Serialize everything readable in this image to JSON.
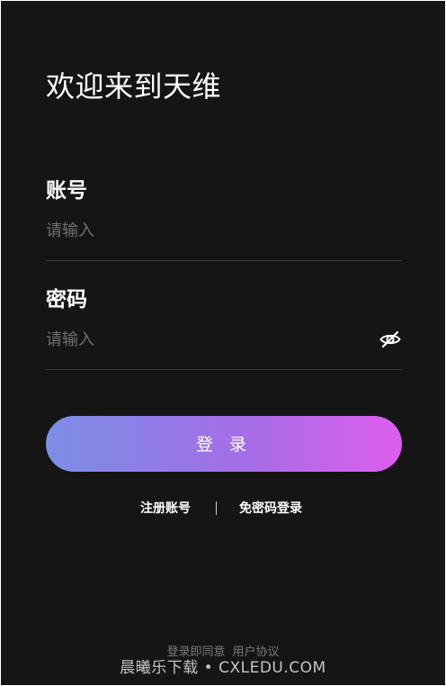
{
  "page": {
    "title": "欢迎来到天维"
  },
  "account": {
    "label": "账号",
    "placeholder": "请输入",
    "value": ""
  },
  "password": {
    "label": "密码",
    "placeholder": "请输入",
    "value": "",
    "toggle_icon": "eye-off-icon"
  },
  "login_button": {
    "label": "登 录",
    "gradient_start": "#7b8ee6",
    "gradient_end": "#de5eee"
  },
  "links": {
    "register": "注册账号",
    "separator": "|",
    "sms_login": "免密码登录"
  },
  "footer": {
    "agreement_prefix": "登录即同意",
    "agreement_link": "用户协议"
  },
  "watermark": {
    "text": "晨曦乐下载 • CXLEDU.COM"
  },
  "colors": {
    "background": "#151515",
    "text": "#ffffff",
    "placeholder": "#6f6f6f",
    "divider": "#3a3a3a"
  }
}
